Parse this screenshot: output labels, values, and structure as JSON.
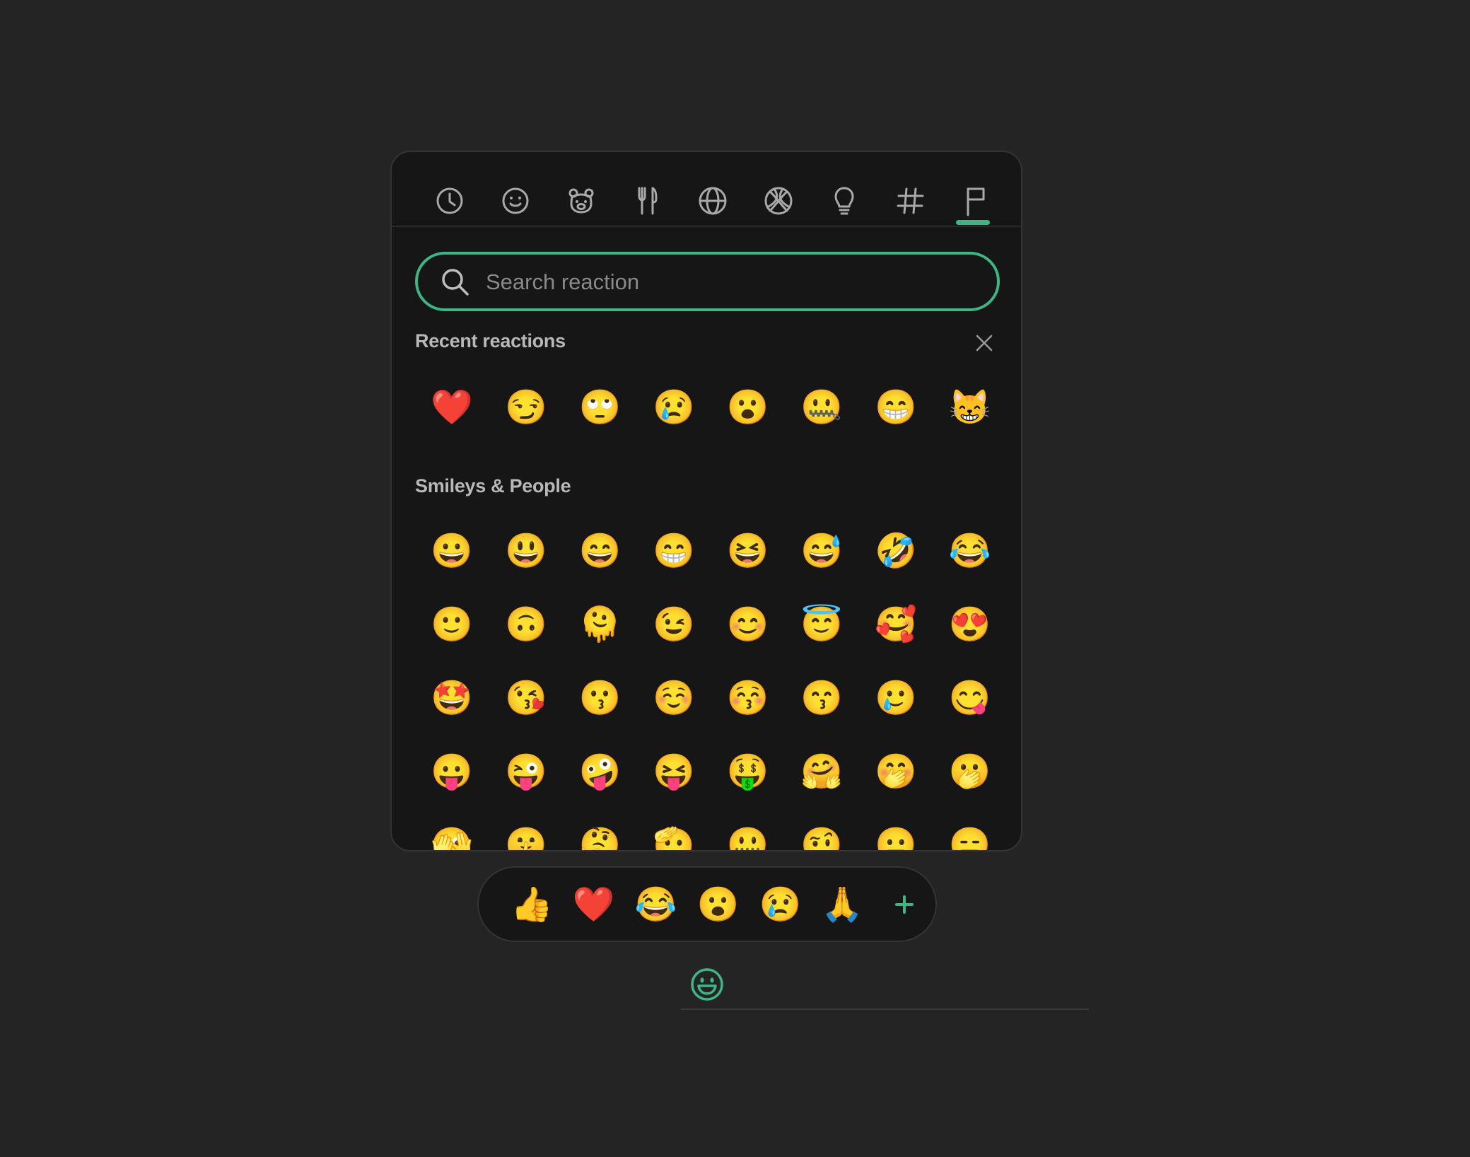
{
  "theme": {
    "accent": "#3eb584",
    "background": "#242424",
    "panel": "#161616"
  },
  "tabs": [
    {
      "icon": "clock-icon",
      "label": "Recent"
    },
    {
      "icon": "smiley-icon",
      "label": "Smileys & People"
    },
    {
      "icon": "bear-icon",
      "label": "Animals & Nature"
    },
    {
      "icon": "fork-knife-icon",
      "label": "Food & Drink"
    },
    {
      "icon": "globe-icon",
      "label": "Travel & Places"
    },
    {
      "icon": "ball-icon",
      "label": "Activities"
    },
    {
      "icon": "lightbulb-icon",
      "label": "Objects"
    },
    {
      "icon": "hash-icon",
      "label": "Symbols"
    },
    {
      "icon": "flag-icon",
      "label": "Flags"
    }
  ],
  "active_tab": "Flags",
  "search": {
    "placeholder": "Search reaction",
    "value": ""
  },
  "recent": {
    "title": "Recent reactions",
    "emojis": [
      "❤️",
      "😏",
      "🙄",
      "😢",
      "😮",
      "🤐",
      "😁",
      "😸"
    ]
  },
  "smileys": {
    "title": "Smileys & People",
    "emojis": [
      "😀",
      "😃",
      "😄",
      "😁",
      "😆",
      "😅",
      "🤣",
      "😂",
      "🙂",
      "🙃",
      "🫠",
      "😉",
      "😊",
      "😇",
      "🥰",
      "😍",
      "🤩",
      "😘",
      "😗",
      "☺️",
      "😚",
      "😙",
      "🥲",
      "😋",
      "😛",
      "😜",
      "🤪",
      "😝",
      "🤑",
      "🤗",
      "🤭",
      "🫢",
      "🫣",
      "🤫",
      "🤔",
      "🫡",
      "🤐",
      "🤨",
      "😐",
      "😑"
    ]
  },
  "quick_reactions": {
    "emojis": [
      "👍",
      "❤️",
      "😂",
      "😮",
      "😢",
      "🙏"
    ],
    "add_label": "+"
  },
  "trigger": {
    "icon": "smiley-icon"
  }
}
